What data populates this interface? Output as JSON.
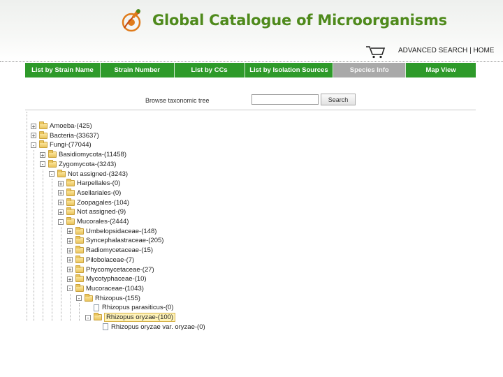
{
  "header": {
    "site_title": "Global Catalogue of Microorganisms",
    "logo_icon": "microbe-logo-icon",
    "cart_icon": "shopping-cart-icon",
    "advanced_search": "ADVANCED SEARCH",
    "separator": "|",
    "home": "HOME",
    "brand_color": "#4f8a1c"
  },
  "nav": {
    "tabs": [
      {
        "label": "List by Strain Name",
        "active": false
      },
      {
        "label": "Strain Number",
        "active": false
      },
      {
        "label": "List by CCs",
        "active": false
      },
      {
        "label": "List by Isolation Sources",
        "active": false
      },
      {
        "label": "Species Info",
        "active": true
      },
      {
        "label": "Map View",
        "active": false
      }
    ],
    "bar_color": "#2e9a2a",
    "active_color": "#a9a9a9"
  },
  "search": {
    "label": "Browse taxonomic tree",
    "value": "",
    "button": "Search"
  },
  "tree": {
    "nodes": [
      {
        "label": "Amoeba-(425)",
        "level": 0,
        "toggle": "+",
        "icon": "folder-icon"
      },
      {
        "label": "Bacteria-(33637)",
        "level": 0,
        "toggle": "+",
        "icon": "folder-icon"
      },
      {
        "label": "Fungi-(77044)",
        "level": 0,
        "toggle": "-",
        "icon": "folder-icon"
      },
      {
        "label": "Basidiomycota-(11458)",
        "level": 1,
        "toggle": "+",
        "icon": "folder-icon"
      },
      {
        "label": "Zygomycota-(3243)",
        "level": 1,
        "toggle": "-",
        "icon": "folder-icon"
      },
      {
        "label": "Not assigned-(3243)",
        "level": 2,
        "toggle": "-",
        "icon": "folder-icon"
      },
      {
        "label": "Harpellales-(0)",
        "level": 3,
        "toggle": "+",
        "icon": "folder-icon"
      },
      {
        "label": "Asellariales-(0)",
        "level": 3,
        "toggle": "+",
        "icon": "folder-icon"
      },
      {
        "label": "Zoopagales-(104)",
        "level": 3,
        "toggle": "+",
        "icon": "folder-icon"
      },
      {
        "label": "Not assigned-(9)",
        "level": 3,
        "toggle": "+",
        "icon": "folder-icon"
      },
      {
        "label": "Mucorales-(2444)",
        "level": 3,
        "toggle": "-",
        "icon": "folder-icon"
      },
      {
        "label": "Umbelopsidaceae-(148)",
        "level": 4,
        "toggle": "+",
        "icon": "folder-icon"
      },
      {
        "label": "Syncephalastraceae-(205)",
        "level": 4,
        "toggle": "+",
        "icon": "folder-icon"
      },
      {
        "label": "Radiomycetaceae-(15)",
        "level": 4,
        "toggle": "+",
        "icon": "folder-icon"
      },
      {
        "label": "Pilobolaceae-(7)",
        "level": 4,
        "toggle": "+",
        "icon": "folder-icon"
      },
      {
        "label": "Phycomycetaceae-(27)",
        "level": 4,
        "toggle": "+",
        "icon": "folder-icon"
      },
      {
        "label": "Mycotyphaceae-(10)",
        "level": 4,
        "toggle": "+",
        "icon": "folder-icon"
      },
      {
        "label": "Mucoraceae-(1043)",
        "level": 4,
        "toggle": "-",
        "icon": "folder-icon"
      },
      {
        "label": "Rhizopus-(155)",
        "level": 5,
        "toggle": "-",
        "icon": "folder-icon"
      },
      {
        "label": "Rhizopus parasiticus-(0)",
        "level": 6,
        "toggle": "",
        "icon": "page-icon"
      },
      {
        "label": "Rhizopus oryzae-(100)",
        "level": 6,
        "toggle": "-",
        "icon": "folder-icon",
        "selected": true
      },
      {
        "label": "Rhizopus oryzae var. oryzae-(0)",
        "level": 7,
        "toggle": "",
        "icon": "page-icon"
      }
    ]
  }
}
